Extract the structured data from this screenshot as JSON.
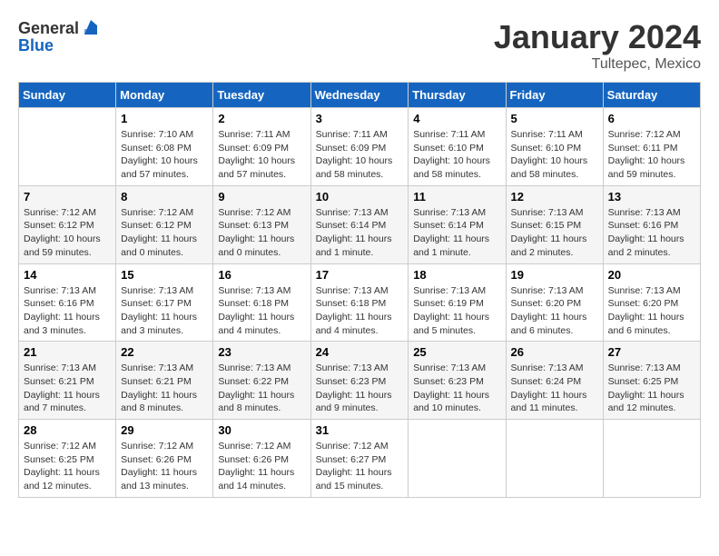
{
  "header": {
    "logo_line1": "General",
    "logo_line2": "Blue",
    "month": "January 2024",
    "location": "Tultepec, Mexico"
  },
  "weekdays": [
    "Sunday",
    "Monday",
    "Tuesday",
    "Wednesday",
    "Thursday",
    "Friday",
    "Saturday"
  ],
  "weeks": [
    [
      {
        "day": "",
        "sunrise": "",
        "sunset": "",
        "daylight": ""
      },
      {
        "day": "1",
        "sunrise": "Sunrise: 7:10 AM",
        "sunset": "Sunset: 6:08 PM",
        "daylight": "Daylight: 10 hours and 57 minutes."
      },
      {
        "day": "2",
        "sunrise": "Sunrise: 7:11 AM",
        "sunset": "Sunset: 6:09 PM",
        "daylight": "Daylight: 10 hours and 57 minutes."
      },
      {
        "day": "3",
        "sunrise": "Sunrise: 7:11 AM",
        "sunset": "Sunset: 6:09 PM",
        "daylight": "Daylight: 10 hours and 58 minutes."
      },
      {
        "day": "4",
        "sunrise": "Sunrise: 7:11 AM",
        "sunset": "Sunset: 6:10 PM",
        "daylight": "Daylight: 10 hours and 58 minutes."
      },
      {
        "day": "5",
        "sunrise": "Sunrise: 7:11 AM",
        "sunset": "Sunset: 6:10 PM",
        "daylight": "Daylight: 10 hours and 58 minutes."
      },
      {
        "day": "6",
        "sunrise": "Sunrise: 7:12 AM",
        "sunset": "Sunset: 6:11 PM",
        "daylight": "Daylight: 10 hours and 59 minutes."
      }
    ],
    [
      {
        "day": "7",
        "sunrise": "Sunrise: 7:12 AM",
        "sunset": "Sunset: 6:12 PM",
        "daylight": "Daylight: 10 hours and 59 minutes."
      },
      {
        "day": "8",
        "sunrise": "Sunrise: 7:12 AM",
        "sunset": "Sunset: 6:12 PM",
        "daylight": "Daylight: 11 hours and 0 minutes."
      },
      {
        "day": "9",
        "sunrise": "Sunrise: 7:12 AM",
        "sunset": "Sunset: 6:13 PM",
        "daylight": "Daylight: 11 hours and 0 minutes."
      },
      {
        "day": "10",
        "sunrise": "Sunrise: 7:13 AM",
        "sunset": "Sunset: 6:14 PM",
        "daylight": "Daylight: 11 hours and 1 minute."
      },
      {
        "day": "11",
        "sunrise": "Sunrise: 7:13 AM",
        "sunset": "Sunset: 6:14 PM",
        "daylight": "Daylight: 11 hours and 1 minute."
      },
      {
        "day": "12",
        "sunrise": "Sunrise: 7:13 AM",
        "sunset": "Sunset: 6:15 PM",
        "daylight": "Daylight: 11 hours and 2 minutes."
      },
      {
        "day": "13",
        "sunrise": "Sunrise: 7:13 AM",
        "sunset": "Sunset: 6:16 PM",
        "daylight": "Daylight: 11 hours and 2 minutes."
      }
    ],
    [
      {
        "day": "14",
        "sunrise": "Sunrise: 7:13 AM",
        "sunset": "Sunset: 6:16 PM",
        "daylight": "Daylight: 11 hours and 3 minutes."
      },
      {
        "day": "15",
        "sunrise": "Sunrise: 7:13 AM",
        "sunset": "Sunset: 6:17 PM",
        "daylight": "Daylight: 11 hours and 3 minutes."
      },
      {
        "day": "16",
        "sunrise": "Sunrise: 7:13 AM",
        "sunset": "Sunset: 6:18 PM",
        "daylight": "Daylight: 11 hours and 4 minutes."
      },
      {
        "day": "17",
        "sunrise": "Sunrise: 7:13 AM",
        "sunset": "Sunset: 6:18 PM",
        "daylight": "Daylight: 11 hours and 4 minutes."
      },
      {
        "day": "18",
        "sunrise": "Sunrise: 7:13 AM",
        "sunset": "Sunset: 6:19 PM",
        "daylight": "Daylight: 11 hours and 5 minutes."
      },
      {
        "day": "19",
        "sunrise": "Sunrise: 7:13 AM",
        "sunset": "Sunset: 6:20 PM",
        "daylight": "Daylight: 11 hours and 6 minutes."
      },
      {
        "day": "20",
        "sunrise": "Sunrise: 7:13 AM",
        "sunset": "Sunset: 6:20 PM",
        "daylight": "Daylight: 11 hours and 6 minutes."
      }
    ],
    [
      {
        "day": "21",
        "sunrise": "Sunrise: 7:13 AM",
        "sunset": "Sunset: 6:21 PM",
        "daylight": "Daylight: 11 hours and 7 minutes."
      },
      {
        "day": "22",
        "sunrise": "Sunrise: 7:13 AM",
        "sunset": "Sunset: 6:21 PM",
        "daylight": "Daylight: 11 hours and 8 minutes."
      },
      {
        "day": "23",
        "sunrise": "Sunrise: 7:13 AM",
        "sunset": "Sunset: 6:22 PM",
        "daylight": "Daylight: 11 hours and 8 minutes."
      },
      {
        "day": "24",
        "sunrise": "Sunrise: 7:13 AM",
        "sunset": "Sunset: 6:23 PM",
        "daylight": "Daylight: 11 hours and 9 minutes."
      },
      {
        "day": "25",
        "sunrise": "Sunrise: 7:13 AM",
        "sunset": "Sunset: 6:23 PM",
        "daylight": "Daylight: 11 hours and 10 minutes."
      },
      {
        "day": "26",
        "sunrise": "Sunrise: 7:13 AM",
        "sunset": "Sunset: 6:24 PM",
        "daylight": "Daylight: 11 hours and 11 minutes."
      },
      {
        "day": "27",
        "sunrise": "Sunrise: 7:13 AM",
        "sunset": "Sunset: 6:25 PM",
        "daylight": "Daylight: 11 hours and 12 minutes."
      }
    ],
    [
      {
        "day": "28",
        "sunrise": "Sunrise: 7:12 AM",
        "sunset": "Sunset: 6:25 PM",
        "daylight": "Daylight: 11 hours and 12 minutes."
      },
      {
        "day": "29",
        "sunrise": "Sunrise: 7:12 AM",
        "sunset": "Sunset: 6:26 PM",
        "daylight": "Daylight: 11 hours and 13 minutes."
      },
      {
        "day": "30",
        "sunrise": "Sunrise: 7:12 AM",
        "sunset": "Sunset: 6:26 PM",
        "daylight": "Daylight: 11 hours and 14 minutes."
      },
      {
        "day": "31",
        "sunrise": "Sunrise: 7:12 AM",
        "sunset": "Sunset: 6:27 PM",
        "daylight": "Daylight: 11 hours and 15 minutes."
      },
      {
        "day": "",
        "sunrise": "",
        "sunset": "",
        "daylight": ""
      },
      {
        "day": "",
        "sunrise": "",
        "sunset": "",
        "daylight": ""
      },
      {
        "day": "",
        "sunrise": "",
        "sunset": "",
        "daylight": ""
      }
    ]
  ]
}
